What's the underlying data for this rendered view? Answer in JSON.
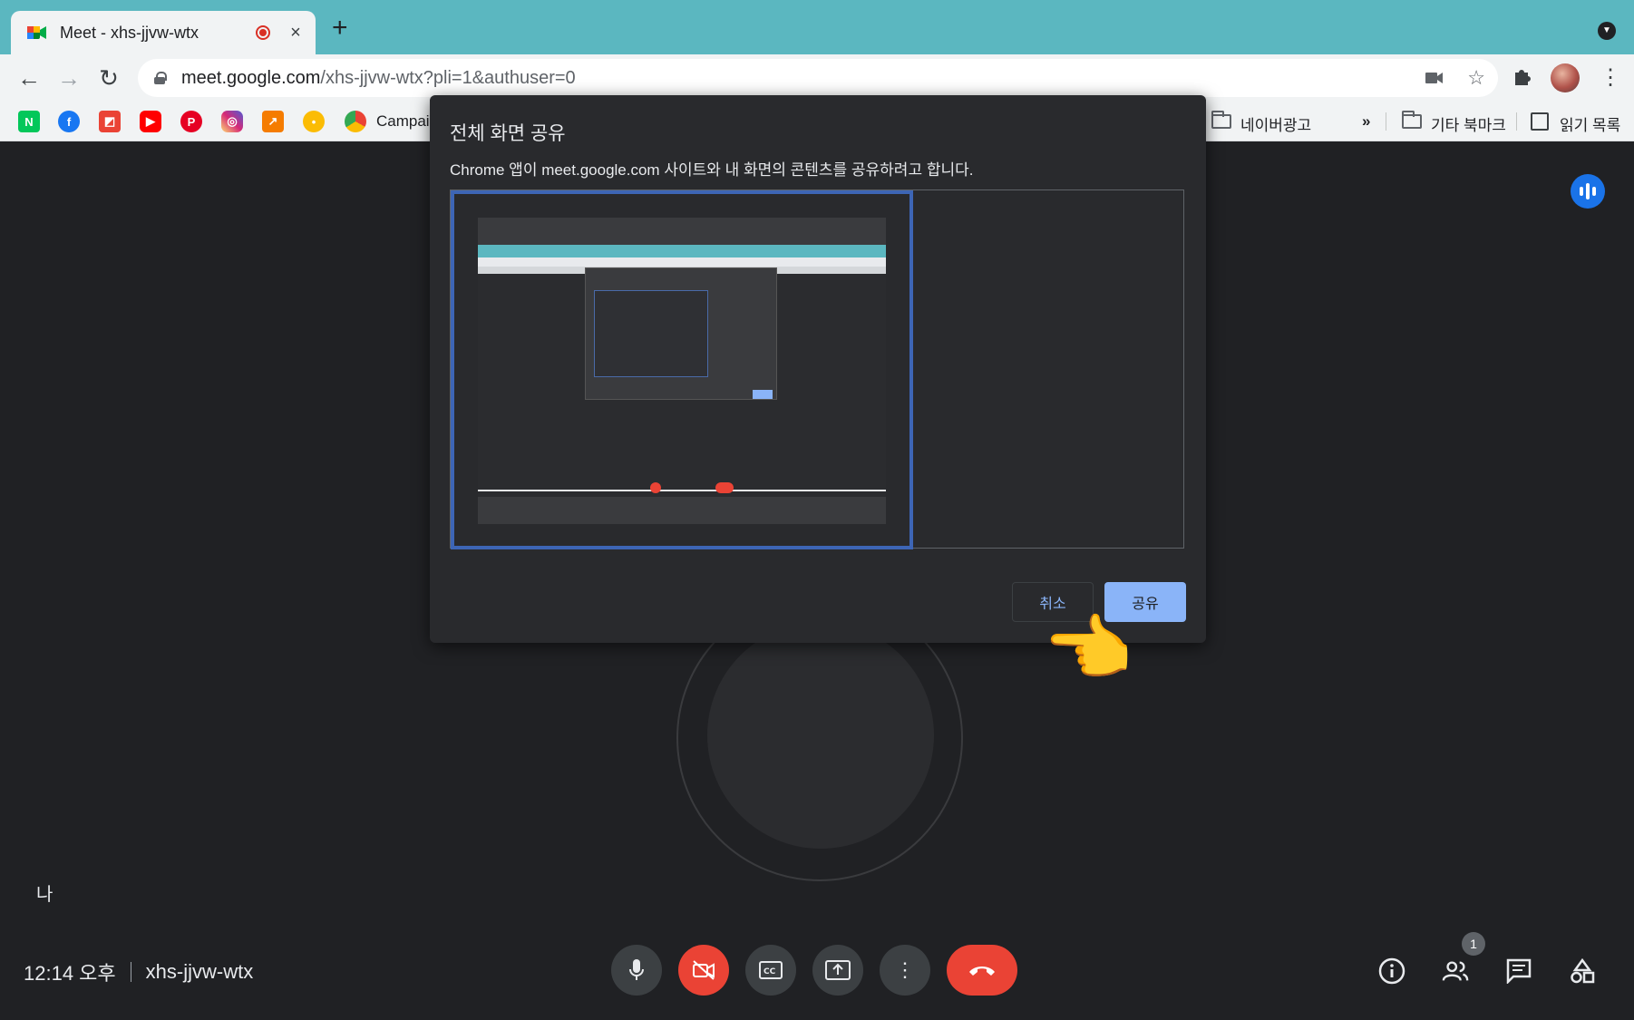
{
  "browser": {
    "tab": {
      "title": "Meet - xhs-jjvw-wtx",
      "close_glyph": "×"
    },
    "new_tab_glyph": "+",
    "url": {
      "host": "meet.google.com",
      "path": "/xhs-jjvw-wtx?pli=1&authuser=0"
    },
    "bookmarks": {
      "campaign": "Campai",
      "naver_ads": "네이버광고",
      "overflow": "»",
      "other_bookmarks": "기타 북마크",
      "reading_list": "읽기 목록"
    },
    "icons": {
      "back": "back-arrow-icon",
      "forward": "forward-arrow-icon",
      "reload": "reload-icon",
      "camera": "camera-icon",
      "star": "bookmark-star-icon",
      "extensions": "puzzle-icon",
      "menu": "kebab-menu-icon"
    }
  },
  "dialog": {
    "title": "전체 화면 공유",
    "description": "Chrome 앱이 meet.google.com 사이트와 내 화면의 콘텐츠를 공유하려고 합니다.",
    "cancel_label": "취소",
    "share_label": "공유",
    "colors": {
      "selection_border": "#3d65b5",
      "primary_button": "#8ab4f8"
    }
  },
  "meet": {
    "self_label": "나",
    "time": "12:14 오후",
    "meeting_code": "xhs-jjvw-wtx",
    "participant_count": "1",
    "controls": [
      "mic-icon",
      "camera-off-icon",
      "captions-icon",
      "present-icon",
      "more-icon",
      "end-call-icon"
    ],
    "right_icons": [
      "info-icon",
      "people-icon",
      "chat-icon",
      "activities-icon"
    ],
    "colors": {
      "background": "#202124",
      "danger": "#ea4335",
      "accent": "#1a73e8"
    }
  },
  "pointer": "👈"
}
